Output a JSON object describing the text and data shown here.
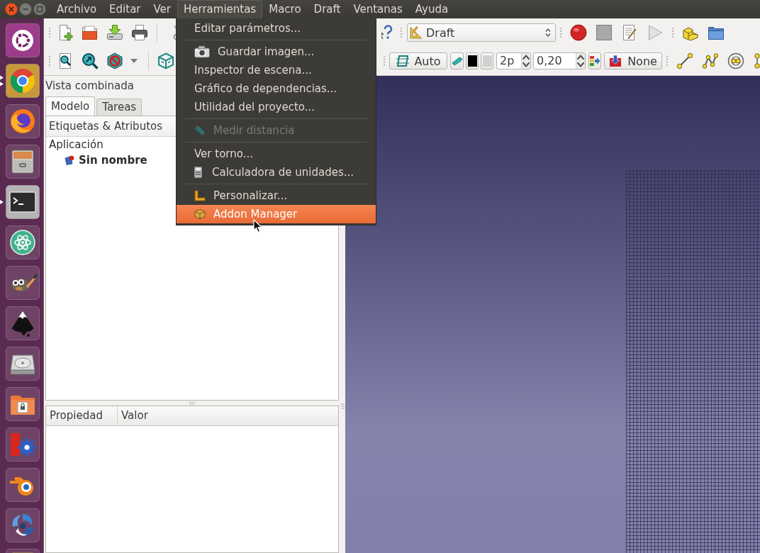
{
  "launcher": [
    {
      "running": false,
      "multiple_windows": false
    },
    {
      "running": true,
      "multiple_windows": true
    },
    {
      "running": false,
      "multiple_windows": false
    },
    {
      "running": false,
      "multiple_windows": false
    },
    {
      "running": true,
      "multiple_windows": false
    },
    {
      "running": false,
      "multiple_windows": false
    },
    {
      "running": false,
      "multiple_windows": false
    },
    {
      "running": false,
      "multiple_windows": false
    },
    {
      "running": false,
      "multiple_windows": false
    },
    {
      "running": false,
      "multiple_windows": false
    },
    {
      "running": false,
      "multiple_windows": false
    },
    {
      "running": false,
      "multiple_windows": false
    },
    {
      "running": false,
      "multiple_windows": false
    }
  ],
  "menu_bar": [
    {
      "label": "Archivo",
      "selected": false
    },
    {
      "label": "Editar",
      "selected": false
    },
    {
      "label": "Ver",
      "selected": false
    },
    {
      "label": "Herramientas",
      "selected": true
    },
    {
      "label": "Macro",
      "selected": false
    },
    {
      "label": "Draft",
      "selected": false
    },
    {
      "label": "Ventanas",
      "selected": false
    },
    {
      "label": "Ayuda",
      "selected": false
    }
  ],
  "toolbar": {
    "workbench": "Draft",
    "plane_button": "Auto",
    "swatches": [
      {
        "color": "#000000"
      },
      {
        "color": "#d0d0d0"
      }
    ],
    "spin_boxes": [
      {
        "value": "2p"
      },
      {
        "value": "0,20"
      }
    ],
    "group_button": "None"
  },
  "tools_menu": [
    {
      "kind": "plain",
      "label": "Editar parámetros...",
      "disabled": false,
      "selected": false
    },
    {
      "kind": "separator"
    },
    {
      "kind": "camera",
      "label": "Guardar imagen...",
      "disabled": false,
      "selected": false
    },
    {
      "kind": "plain",
      "label": "Inspector de escena...",
      "disabled": false,
      "selected": false
    },
    {
      "kind": "plain",
      "label": "Gráfico de dependencias...",
      "disabled": false,
      "selected": false
    },
    {
      "kind": "plain",
      "label": "Utilidad del proyecto...",
      "disabled": false,
      "selected": false
    },
    {
      "kind": "separator"
    },
    {
      "kind": "ruler",
      "label": "Medir distancia",
      "disabled": true,
      "selected": false
    },
    {
      "kind": "separator"
    },
    {
      "kind": "plain",
      "label": "Ver torno...",
      "disabled": false,
      "selected": false
    },
    {
      "kind": "calculator",
      "label": "Calculadora de unidades...",
      "disabled": false,
      "selected": false
    },
    {
      "kind": "separator"
    },
    {
      "kind": "setsquare",
      "label": "Personalizar...",
      "disabled": false,
      "selected": false
    },
    {
      "kind": "box",
      "label": "Addon Manager",
      "disabled": false,
      "selected": true
    }
  ],
  "combo_view": {
    "title": "Vista combinada",
    "tabs": [
      {
        "label": "Modelo",
        "selected": true
      },
      {
        "label": "Tareas",
        "selected": false
      }
    ],
    "tree": {
      "header": "Etiquetas & Atributos",
      "items": [
        {
          "label": "Aplicación",
          "active": false,
          "children": [
            {
              "label": "Sin nombre",
              "active": true
            }
          ]
        }
      ]
    },
    "properties": {
      "columns": [
        "Propiedad",
        "Valor"
      ]
    }
  }
}
